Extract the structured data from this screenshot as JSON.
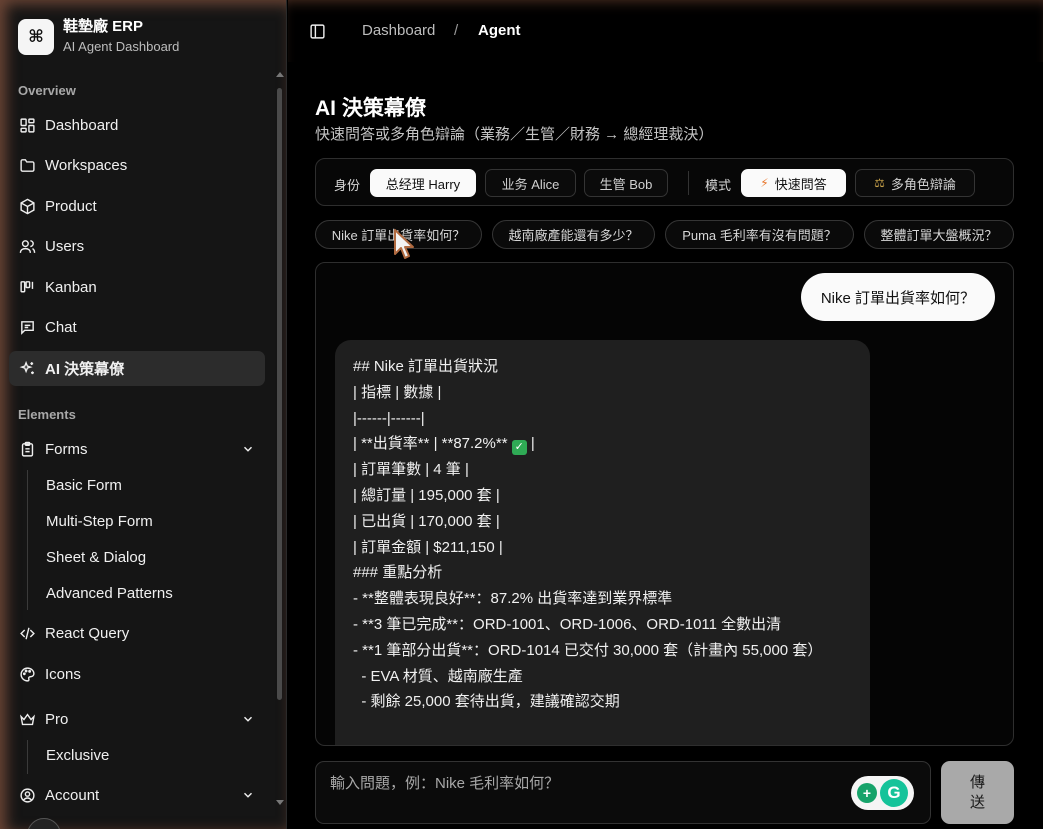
{
  "brand": {
    "logo_glyph": "⌘",
    "title": "鞋墊廠 ERP",
    "subtitle": "AI Agent Dashboard"
  },
  "sidebar": {
    "overview_label": "Overview",
    "overview_items": [
      {
        "label": "Dashboard",
        "icon": "dashboard-icon"
      },
      {
        "label": "Workspaces",
        "icon": "folder-icon"
      },
      {
        "label": "Product",
        "icon": "package-icon"
      },
      {
        "label": "Users",
        "icon": "users-icon"
      },
      {
        "label": "Kanban",
        "icon": "kanban-icon"
      },
      {
        "label": "Chat",
        "icon": "chat-icon"
      },
      {
        "label": "AI 決策幕僚",
        "icon": "sparkles-icon",
        "active": true
      }
    ],
    "elements_label": "Elements",
    "forms": {
      "label": "Forms",
      "icon": "clipboard-icon",
      "children": [
        "Basic Form",
        "Multi-Step Form",
        "Sheet & Dialog",
        "Advanced Patterns"
      ]
    },
    "react_query": {
      "label": "React Query",
      "icon": "code-icon"
    },
    "icons": {
      "label": "Icons",
      "icon": "palette-icon"
    },
    "pro": {
      "label": "Pro",
      "icon": "crown-icon",
      "children": [
        "Exclusive"
      ]
    },
    "account": {
      "label": "Account",
      "icon": "user-circle-icon"
    }
  },
  "header": {
    "breadcrumb": [
      "Dashboard",
      "Agent"
    ],
    "separator": "/"
  },
  "page": {
    "title": "AI 決策幕僚",
    "subtitle": "快速問答或多角色辯論（業務／生管／財務 → 總經理裁決）"
  },
  "controls": {
    "role_label": "身份",
    "roles": [
      {
        "label": "总经理 Harry",
        "selected": true
      },
      {
        "label": "业务 Alice",
        "selected": false
      },
      {
        "label": "生管 Bob",
        "selected": false
      }
    ],
    "mode_label": "模式",
    "modes": [
      {
        "label": "快速問答",
        "emoji": "⚡",
        "selected": true
      },
      {
        "label": "多角色辯論",
        "emoji": "⚖",
        "selected": false
      }
    ]
  },
  "quick_questions": [
    "Nike 訂單出貨率如何？",
    "越南廠產能還有多少？",
    "Puma 毛利率有沒有問題？",
    "整體訂單大盤概況？"
  ],
  "chat": {
    "user_message": "Nike 訂單出貨率如何？",
    "assistant_lines": [
      "## Nike 訂單出貨狀況",
      "",
      "| 指標 | 數據 |",
      "|------|------|",
      "| **出貨率** | **87.2%** ✅ |",
      "| 訂單筆數 | 4 筆 |",
      "| 總訂量 | 195,000 套 |",
      "| 已出貨 | 170,000 套 |",
      "| 訂單金額 | $211,150 |",
      "",
      "### 重點分析",
      "- **整體表現良好**：87.2% 出貨率達到業界標準",
      "- **3 筆已完成**：ORD-1001、ORD-1006、ORD-1011 全數出清",
      "- **1 筆部分出貨**：ORD-1014 已交付 30,000 套（計畫內 55,000 套）",
      "  - EVA 材質、越南廠生產",
      "  - 剩餘 25,000 套待出貨，建議確認交期"
    ]
  },
  "composer": {
    "placeholder": "輸入問題，例：Nike 毛利率如何？",
    "value": "",
    "send_label": "傳送"
  },
  "colors": {
    "accent_glow": "#b46e50",
    "selected_pill": "#fafafa",
    "bubble_bg": "#1f1f1f"
  }
}
